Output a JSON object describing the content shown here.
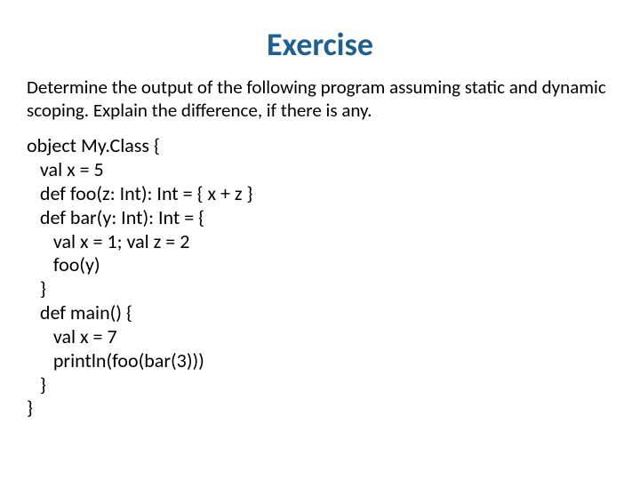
{
  "title": "Exercise",
  "prompt": "Determine the output of the following program assuming static and dynamic scoping. Explain the difference, if there is any.",
  "code": "object My.Class {\n   val x = 5\n   def foo(z: Int): Int = { x + z }\n   def bar(y: Int): Int = {\n      val x = 1; val z = 2\n      foo(y)\n   }\n   def main() {\n      val x = 7\n      println(foo(bar(3)))\n   }\n}"
}
